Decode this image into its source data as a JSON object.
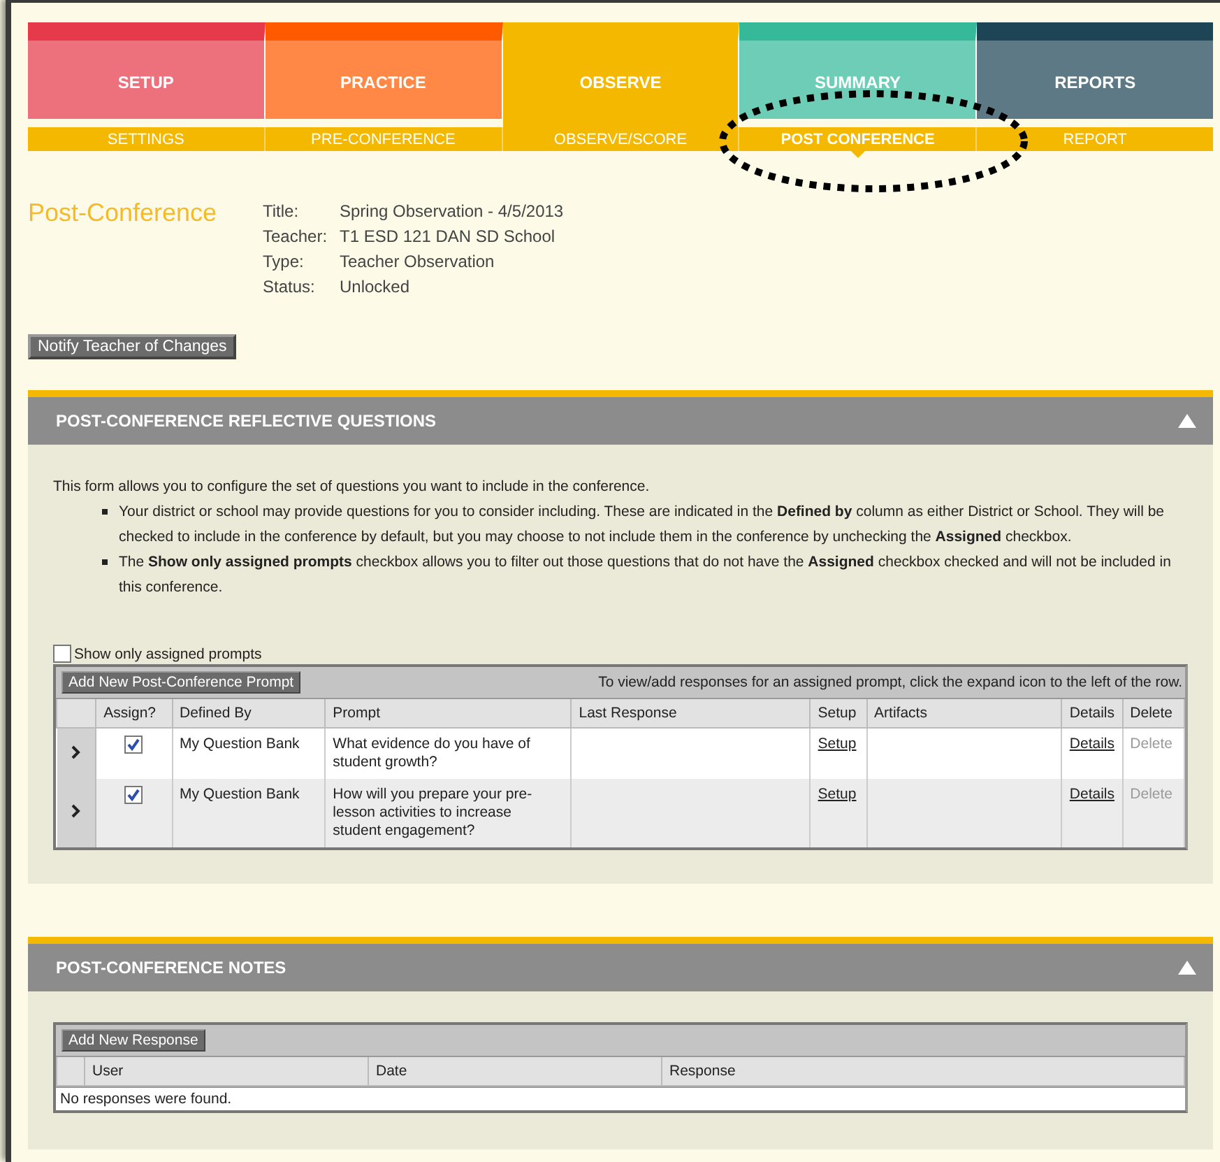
{
  "main_tabs": [
    {
      "label": "SETUP",
      "color": "#e63a4a",
      "selected": false
    },
    {
      "label": "PRACTICE",
      "color": "#ff5a00",
      "selected": false
    },
    {
      "label": "OBSERVE",
      "color": "#f4b800",
      "selected": true
    },
    {
      "label": "SUMMARY",
      "color": "#35b999",
      "selected": false
    },
    {
      "label": "REPORTS",
      "color": "#1e4556",
      "selected": false
    }
  ],
  "sub_tabs": [
    {
      "label": "SETTINGS",
      "selected": false
    },
    {
      "label": "PRE-CONFERENCE",
      "selected": false
    },
    {
      "label": "OBSERVE/SCORE",
      "selected": false
    },
    {
      "label": "POST CONFERENCE",
      "selected": true
    },
    {
      "label": "REPORT",
      "selected": false
    }
  ],
  "page_title": "Post-Conference",
  "details": [
    {
      "label": "Title:",
      "value": "Spring Observation - 4/5/2013"
    },
    {
      "label": "Teacher:",
      "value": "T1 ESD 121 DAN SD School"
    },
    {
      "label": "Type:",
      "value": "Teacher Observation"
    },
    {
      "label": "Status:",
      "value": "Unlocked"
    }
  ],
  "notify_button": "Notify Teacher of Changes",
  "questions_section": {
    "title": "POST-CONFERENCE REFLECTIVE QUESTIONS",
    "expanded": true,
    "intro": "This form allows you to configure the set of questions you want to include in the conference.",
    "bullets": [
      "Your district or school may provide questions for you to consider including. These are indicated in the **Defined by** column as either District or School. They will be checked to include in the conference by default, but you may choose to not include them in the conference by unchecking the **Assigned** checkbox.",
      "The **Show only assigned prompts** checkbox allows you to filter out those questions that do not have the **Assigned** checkbox checked and will not be included in this conference."
    ],
    "filter": {
      "label": "Show only assigned prompts",
      "checked": false
    },
    "table": {
      "add_button": "Add New Post-Conference Prompt",
      "hint": "To view/add responses for an assigned prompt, click the expand icon to the left of the row.",
      "columns": [
        "Assign?",
        "Defined By",
        "Prompt",
        "Last Response",
        "Setup",
        "Artifacts",
        "Details",
        "Delete"
      ],
      "rows": [
        {
          "expanded": false,
          "assigned": true,
          "defined_by": "My Question Bank",
          "prompt": "What evidence do you have of student growth?",
          "setup": "Setup",
          "details": "Details",
          "delete": "Delete",
          "delete_disabled": true
        },
        {
          "expanded": false,
          "assigned": true,
          "defined_by": "My Question Bank",
          "prompt": "How will you prepare your pre-lesson activities to increase student engagement?",
          "setup": "Setup",
          "details": "Details",
          "delete": "Delete",
          "delete_disabled": true
        }
      ]
    }
  },
  "notes_section": {
    "title": "POST-CONFERENCE NOTES",
    "expanded": true,
    "table": {
      "add_button": "Add New Response",
      "columns": [
        "User",
        "Date",
        "Response"
      ],
      "empty_message": "No responses were found."
    }
  }
}
